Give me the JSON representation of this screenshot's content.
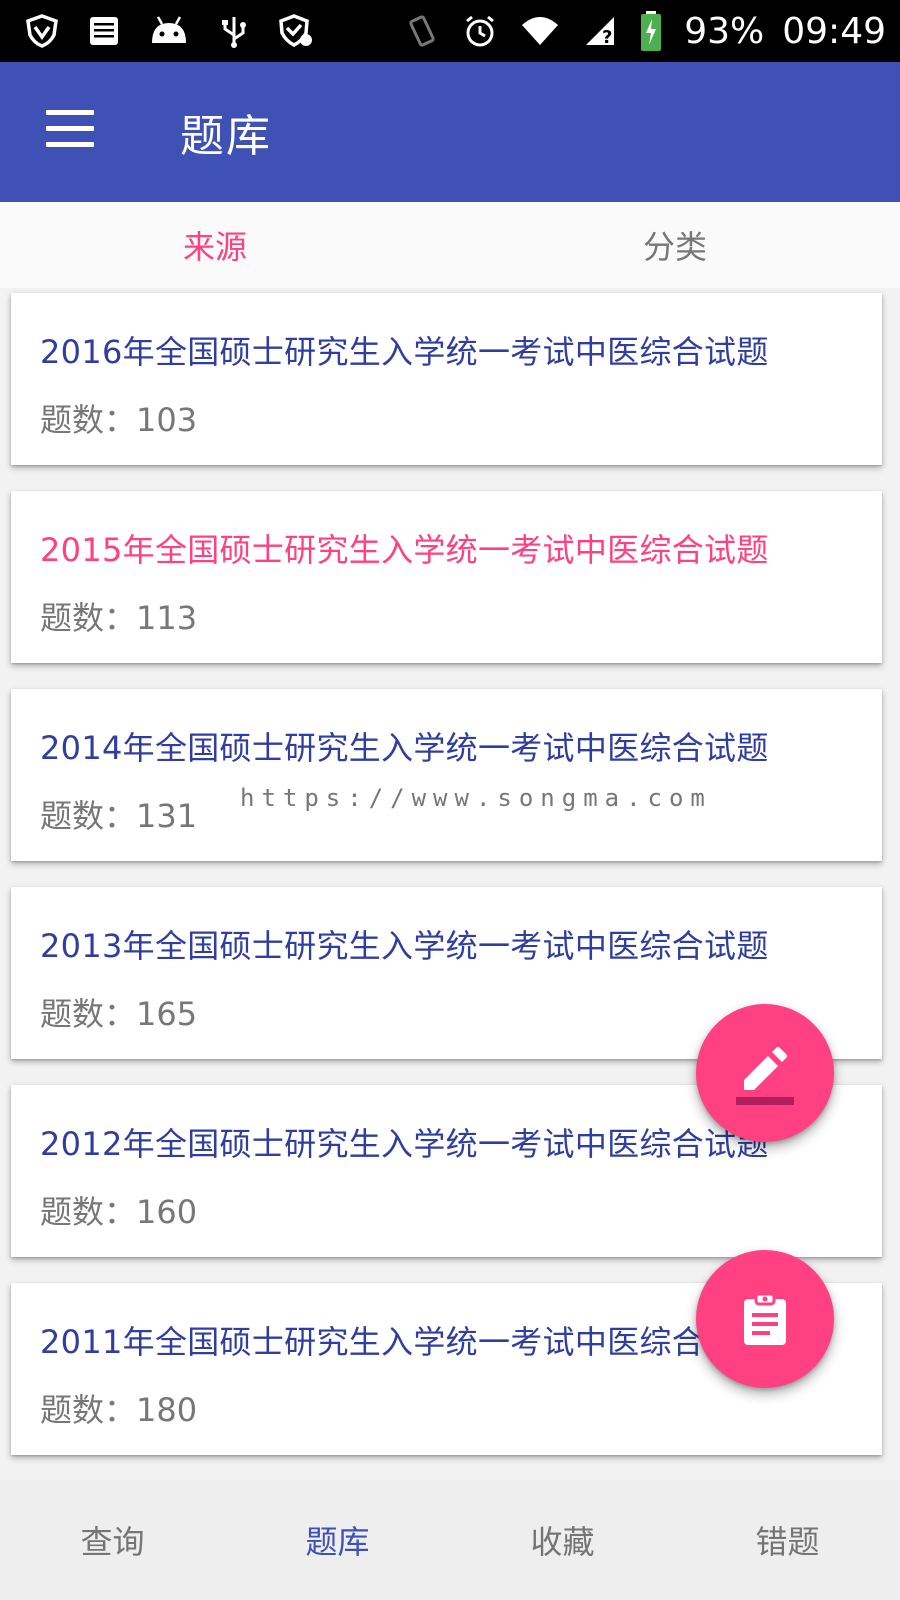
{
  "status_bar": {
    "battery_percent": "93%",
    "time": "09:49"
  },
  "app_bar": {
    "title": "题库",
    "menu_icon": "menu-icon"
  },
  "tabs": [
    {
      "label": "来源",
      "active": true
    },
    {
      "label": "分类",
      "active": false
    }
  ],
  "questions": [
    {
      "title": "2016年全国硕士研究生入学统一考试中医综合试题",
      "count": "题数：103",
      "highlighted": false
    },
    {
      "title": "2015年全国硕士研究生入学统一考试中医综合试题",
      "count": "题数：113",
      "highlighted": true
    },
    {
      "title": "2014年全国硕士研究生入学统一考试中医综合试题",
      "count": "题数：131",
      "highlighted": false
    },
    {
      "title": "2013年全国硕士研究生入学统一考试中医综合试题",
      "count": "题数：165",
      "highlighted": false
    },
    {
      "title": "2012年全国硕士研究生入学统一考试中医综合试题",
      "count": "题数：160",
      "highlighted": false
    },
    {
      "title": "2011年全国硕士研究生入学统一考试中医综合试题",
      "count": "题数：180",
      "highlighted": false
    }
  ],
  "watermark": "https://www.songma.com",
  "fabs": {
    "edit_icon": "edit-icon",
    "clipboard_icon": "clipboard-icon"
  },
  "bottom_nav": [
    {
      "label": "查询",
      "active": false
    },
    {
      "label": "题库",
      "active": true
    },
    {
      "label": "收藏",
      "active": false
    },
    {
      "label": "错题",
      "active": false
    }
  ],
  "colors": {
    "primary": "#3f51b5",
    "accent": "#ff4081",
    "title_text": "#303f9f"
  }
}
